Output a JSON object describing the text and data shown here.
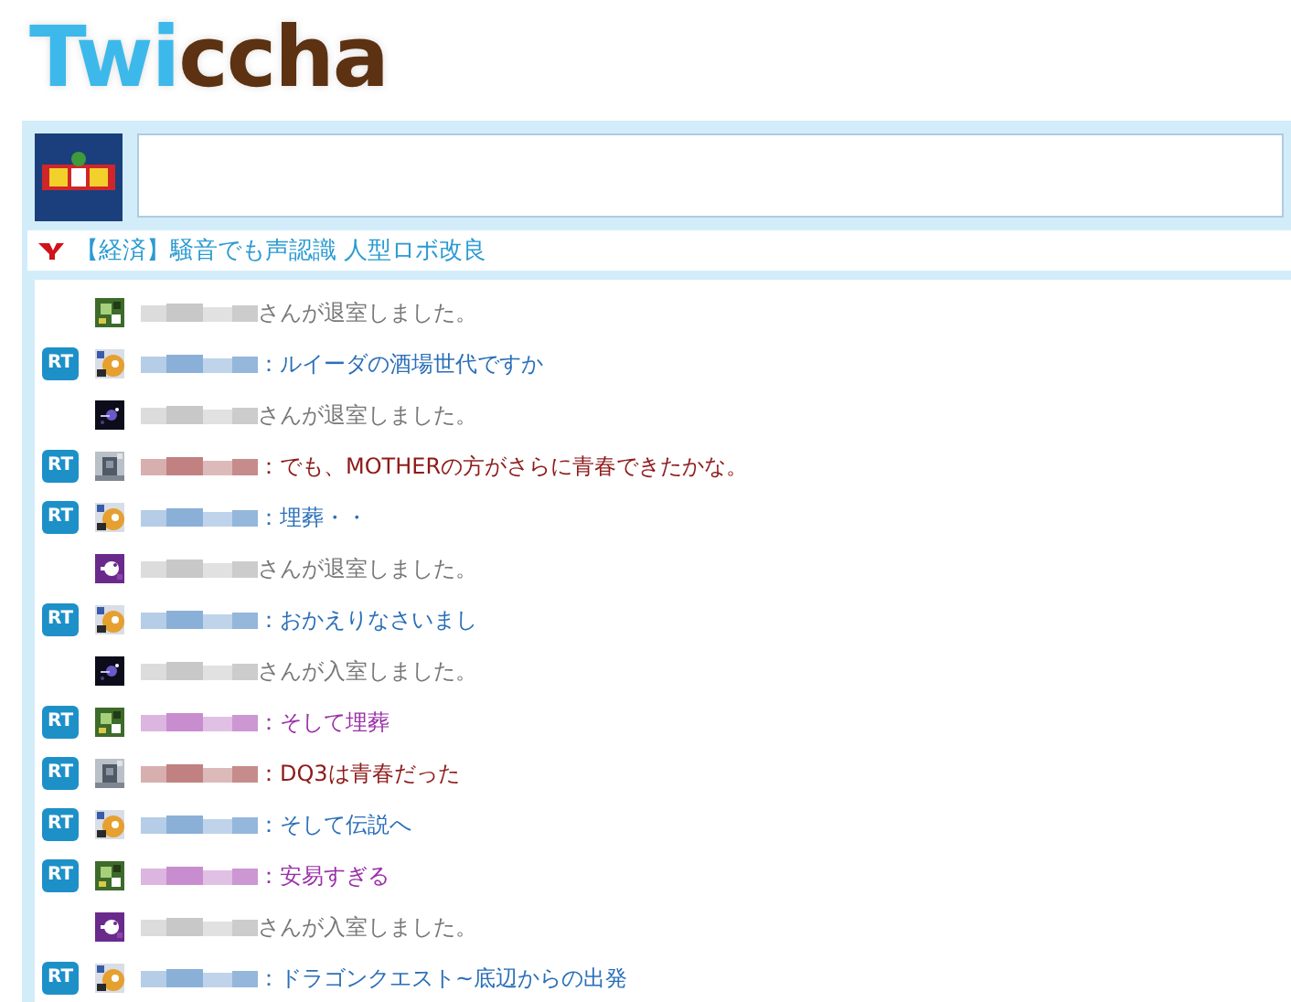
{
  "logo": "Twiccha",
  "news": {
    "text": "【経済】騒音でも声認識 人型ロボ改良"
  },
  "rows": [
    {
      "kind": "system",
      "text": "さんが退室しました。"
    },
    {
      "kind": "message",
      "badge": "RT",
      "text": "：ルイーダの酒場世代ですか",
      "color": "#2a6fb8"
    },
    {
      "kind": "system",
      "text": "さんが退室しました。"
    },
    {
      "kind": "message",
      "badge": "RT",
      "text": "：でも、MOTHERの方がさらに青春できたかな。",
      "color": "#8e1a1a"
    },
    {
      "kind": "message",
      "badge": "RT",
      "text": "：埋葬・・",
      "color": "#2a6fb8"
    },
    {
      "kind": "system",
      "text": "さんが退室しました。"
    },
    {
      "kind": "message",
      "badge": "RT",
      "text": "：おかえりなさいまし",
      "color": "#2a6fb8"
    },
    {
      "kind": "system",
      "text": "さんが入室しました。"
    },
    {
      "kind": "message",
      "badge": "RT",
      "text": "：そして埋葬",
      "color": "#9a2fa8"
    },
    {
      "kind": "message",
      "badge": "RT",
      "text": "：DQ3は青春だった",
      "color": "#8e1a1a"
    },
    {
      "kind": "message",
      "badge": "RT",
      "text": "：そして伝説へ",
      "color": "#2a6fb8"
    },
    {
      "kind": "message",
      "badge": "RT",
      "text": "：安易すぎる",
      "color": "#9a2fa8"
    },
    {
      "kind": "system",
      "text": "さんが入室しました。"
    },
    {
      "kind": "message",
      "badge": "RT",
      "text": "：ドラゴンクエスト~底辺からの出発",
      "color": "#2a6fb8"
    }
  ]
}
